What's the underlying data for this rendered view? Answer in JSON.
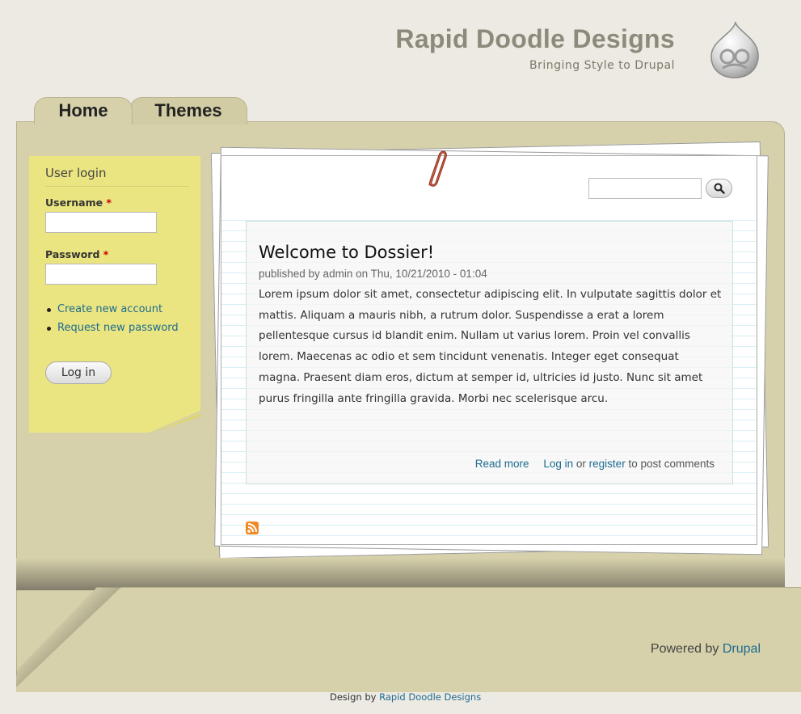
{
  "header": {
    "site_name": "Rapid Doodle Designs",
    "site_slogan": "Bringing Style to Drupal",
    "logo_icon": "drupal-drop-icon"
  },
  "tabs": [
    {
      "label": "Home",
      "active": true
    },
    {
      "label": "Themes",
      "active": false
    }
  ],
  "login": {
    "title": "User login",
    "username_label": "Username",
    "password_label": "Password",
    "required_marker": "*",
    "username_value": "",
    "password_value": "",
    "links": [
      "Create new account",
      "Request new password"
    ],
    "button_label": "Log in"
  },
  "search": {
    "value": "",
    "button_icon": "search-icon"
  },
  "node": {
    "title": "Welcome to Dossier!",
    "meta": "published by admin on Thu, 10/21/2010 - 01:04",
    "body": "Lorem ipsum dolor sit amet, consectetur adipiscing elit. In vulputate sagittis dolor et mattis. Aliquam a mauris nibh, a rutrum dolor. Suspendisse a erat a lorem pellentesque cursus id blandit enim. Nullam ut varius lorem. Proin vel convallis lorem. Maecenas ac odio et sem tincidunt venenatis. Integer eget consequat magna. Praesent diam eros, dictum at semper id, ultricies id justo. Nunc sit amet purus fringilla ante fringilla gravida. Morbi nec scelerisque arcu.",
    "read_more": "Read more",
    "login_link": "Log in",
    "or_text": "or",
    "register_link": "register",
    "comment_suffix": "to post comments"
  },
  "feed_icon": "rss-icon",
  "footer": {
    "powered_prefix": "Powered by",
    "powered_link": "Drupal",
    "credit_prefix": "Design by",
    "credit_link": "Rapid Doodle Designs"
  },
  "colors": {
    "background": "#edeae3",
    "folder": "#d6d1ab",
    "sticky_note": "#ebe581",
    "link": "#1e6b8f"
  }
}
